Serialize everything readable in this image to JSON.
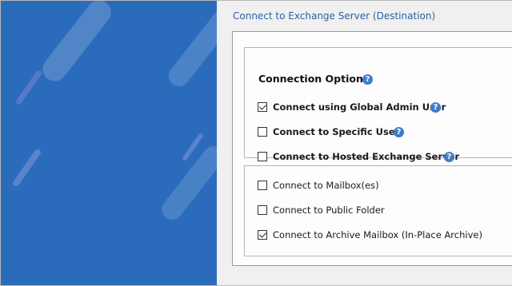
{
  "header": {
    "title": "Connect to Exchange Server (Destination)"
  },
  "connection_option": {
    "title": "Connection Option",
    "help_glyph": "?",
    "options": [
      {
        "label": "Connect using Global Admin User",
        "checked": true
      },
      {
        "label": "Connect to Specific User",
        "checked": false
      },
      {
        "label": "Connect to Hosted Exchange Server",
        "checked": false
      }
    ]
  },
  "targets": {
    "options": [
      {
        "label": "Connect to Mailbox(es)",
        "checked": false
      },
      {
        "label": "Connect to Public Folder",
        "checked": false
      },
      {
        "label": "Connect to Archive Mailbox (In-Place Archive)",
        "checked": true
      }
    ]
  },
  "colors": {
    "hero": "#2a6cbb",
    "accent": "#2b5fa6",
    "help": "#3d7cc9"
  }
}
